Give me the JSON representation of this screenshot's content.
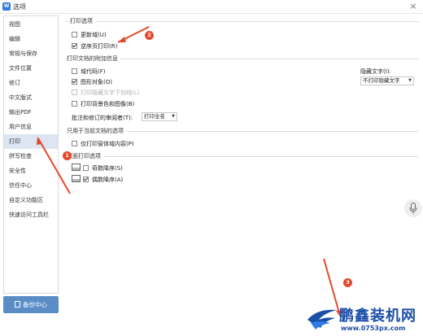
{
  "window": {
    "title": "选项",
    "app_icon_text": "W"
  },
  "sidebar": {
    "items": [
      {
        "label": "视图"
      },
      {
        "label": "编辑"
      },
      {
        "label": "常规与保存"
      },
      {
        "label": "文件位置"
      },
      {
        "label": "修订"
      },
      {
        "label": "中文版式"
      },
      {
        "label": "输出PDF"
      },
      {
        "label": "用户信息"
      },
      {
        "label": "打印",
        "active": true
      },
      {
        "label": "拼写检查"
      },
      {
        "label": "安全性"
      },
      {
        "label": "信任中心"
      },
      {
        "label": "自定义功能区"
      },
      {
        "label": "快速访问工具栏"
      }
    ],
    "backup_button": "备份中心"
  },
  "print_options": {
    "title": "打印选项",
    "update_fields": {
      "label": "更新域(U)",
      "checked": false
    },
    "reverse_order": {
      "label": "逆序页打印(R)",
      "checked": true
    }
  },
  "doc_extra": {
    "title": "打印文档的附加信息",
    "field_codes": {
      "label": "域代码(F)",
      "checked": false
    },
    "drawing_objects": {
      "label": "图形对象(O)",
      "checked": true
    },
    "hidden_text_underline": {
      "label": "打印隐藏文字下划线(L)",
      "checked": false,
      "disabled": true
    },
    "background": {
      "label": "打印背景色和图像(B)",
      "checked": false
    },
    "hidden_text_label": "隐藏文字(I):",
    "hidden_text_value": "不打印隐藏文字",
    "annotations_label": "批注和修订的审阅者(T):",
    "annotations_value": "打印全名"
  },
  "current_doc": {
    "title": "只用于当前文档的选项",
    "form_data_only": {
      "label": "仅打印窗体域内容(P)",
      "checked": false
    }
  },
  "duplex": {
    "title": "双面打印选项",
    "odd_reverse": {
      "label": "奇数降序(S)",
      "checked": false
    },
    "even_reverse": {
      "label": "偶数降序(A)",
      "checked": true
    }
  },
  "annotations": {
    "badge1": "1",
    "badge2": "2",
    "badge3": "3"
  },
  "watermark": {
    "name": "鹏鑫装机网",
    "url": "www.0753px.com"
  },
  "colors": {
    "accent": "#5a8cc5",
    "active_nav": "#dce6f3",
    "arrow": "#e5492c"
  }
}
